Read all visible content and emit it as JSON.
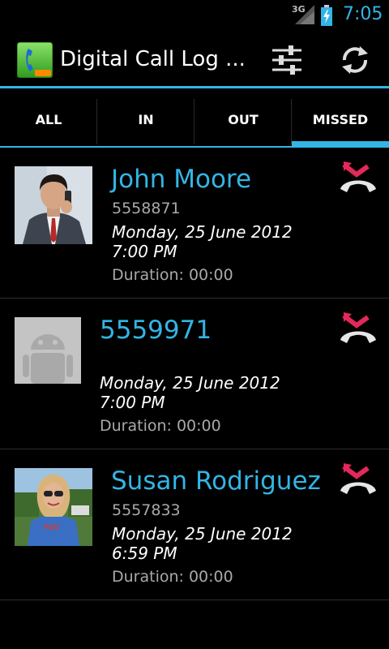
{
  "status_bar": {
    "network": "3G",
    "time": "7:05"
  },
  "action_bar": {
    "title": "Digital Call Log ..."
  },
  "tabs": [
    {
      "label": "ALL"
    },
    {
      "label": "IN"
    },
    {
      "label": "OUT"
    },
    {
      "label": "MISSED",
      "selected": true
    }
  ],
  "calls": [
    {
      "name": "John Moore",
      "number": "5558871",
      "date": "Monday, 25 June 2012",
      "time": "7:00 PM",
      "duration": "Duration: 00:00",
      "type": "missed"
    },
    {
      "name": "5559971",
      "number": "",
      "date": "Monday, 25 June 2012",
      "time": "7:00 PM",
      "duration": "Duration: 00:00",
      "type": "missed"
    },
    {
      "name": "Susan Rodriguez",
      "number": "5557833",
      "date": "Monday, 25 June 2012",
      "time": "6:59 PM",
      "duration": "Duration: 00:00",
      "type": "missed"
    }
  ],
  "colors": {
    "accent": "#33b5e5",
    "missed": "#e3285a",
    "background": "#000000"
  }
}
